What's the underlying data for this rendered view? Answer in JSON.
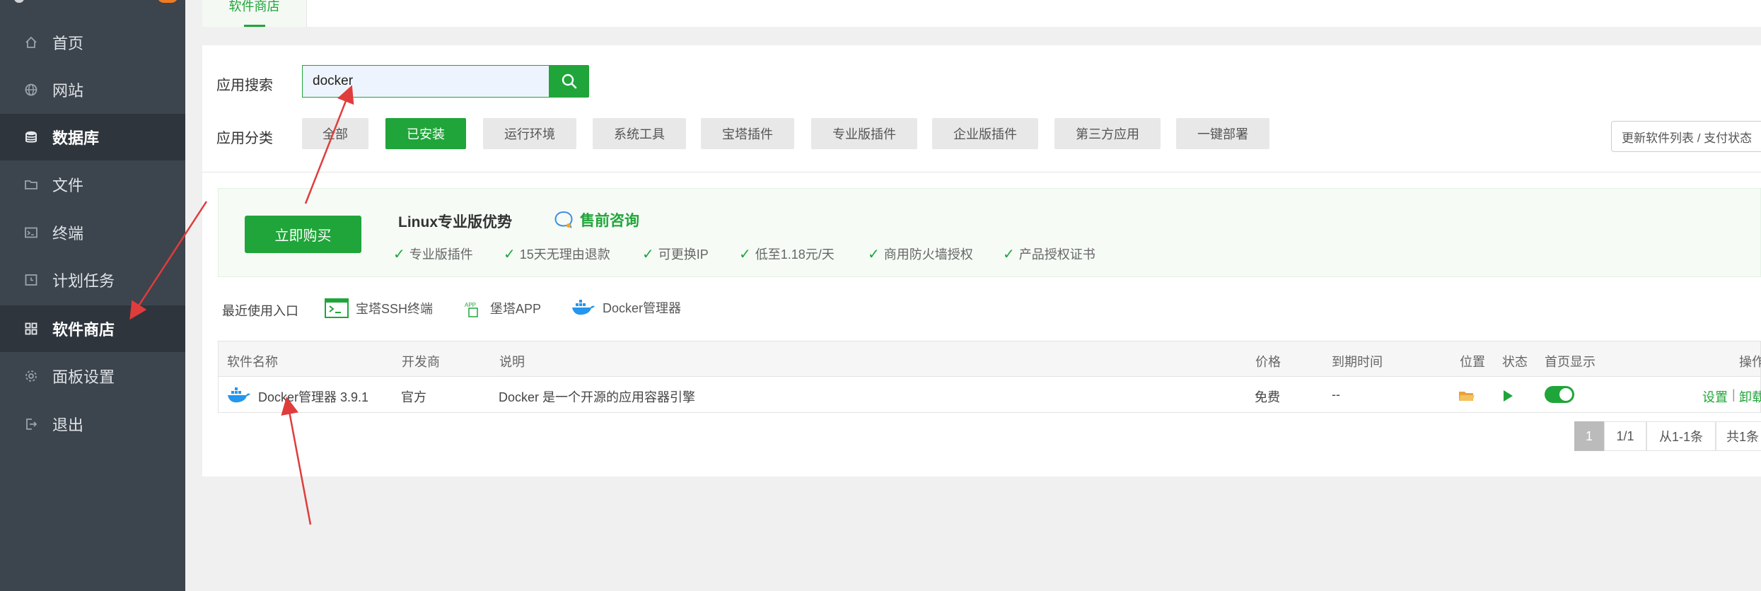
{
  "sidebar": {
    "items": [
      {
        "label": "首页",
        "icon": "home-icon"
      },
      {
        "label": "网站",
        "icon": "globe-icon"
      },
      {
        "label": "数据库",
        "icon": "database-icon"
      },
      {
        "label": "文件",
        "icon": "folder-icon"
      },
      {
        "label": "终端",
        "icon": "terminal-icon"
      },
      {
        "label": "计划任务",
        "icon": "clock-icon"
      },
      {
        "label": "软件商店",
        "icon": "grid-icon"
      },
      {
        "label": "面板设置",
        "icon": "gear-icon"
      },
      {
        "label": "退出",
        "icon": "logout-icon"
      }
    ]
  },
  "tabs": {
    "active": "软件商店"
  },
  "search": {
    "label": "应用搜索",
    "value": "docker"
  },
  "categories": {
    "label": "应用分类",
    "items": [
      "全部",
      "已安装",
      "运行环境",
      "系统工具",
      "宝塔插件",
      "专业版插件",
      "企业版插件",
      "第三方应用",
      "一键部署"
    ],
    "selected": "已安装"
  },
  "update_button": "更新软件列表 / 支付状态",
  "promo": {
    "buy_label": "立即购买",
    "title": "Linux专业版优势",
    "consult": "售前咨询",
    "features": [
      "专业版插件",
      "15天无理由退款",
      "可更换IP",
      "低至1.18元/天",
      "商用防火墙授权",
      "产品授权证书"
    ]
  },
  "recent": {
    "label": "最近使用入口",
    "items": [
      "宝塔SSH终端",
      "堡塔APP",
      "Docker管理器"
    ]
  },
  "table": {
    "headers": {
      "name": "软件名称",
      "developer": "开发商",
      "desc": "说明",
      "price": "价格",
      "expire": "到期时间",
      "location": "位置",
      "status": "状态",
      "homepage": "首页显示",
      "ops": "操作"
    },
    "rows": [
      {
        "name": "Docker管理器 3.9.1",
        "developer": "官方",
        "desc": "Docker 是一个开源的应用容器引擎",
        "price": "免费",
        "expire": "--",
        "ops_settings": "设置",
        "ops_sep": "|",
        "ops_uninstall": "卸载"
      }
    ]
  },
  "pagination": {
    "current": "1",
    "pages": "1/1",
    "range": "从1-1条",
    "total": "共1条"
  },
  "colors": {
    "accent": "#20a53a",
    "sidebar": "#3c444d",
    "annotation_arrow": "#e03c3c"
  }
}
